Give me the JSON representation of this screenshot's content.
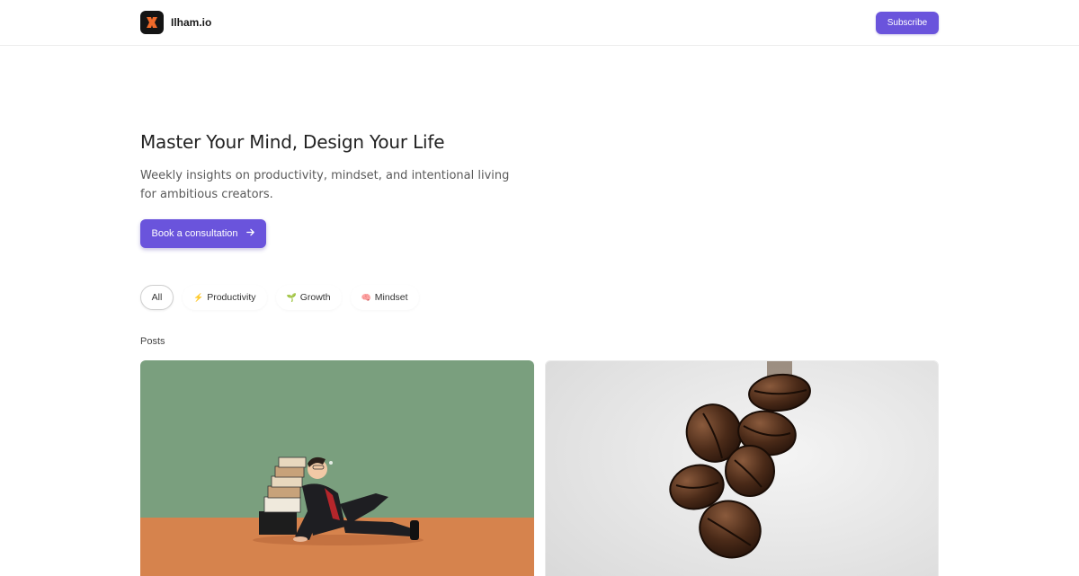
{
  "header": {
    "brand_name": "Ilham.io",
    "subscribe_label": "Subscribe"
  },
  "hero": {
    "title": "Master Your Mind, Design Your Life",
    "subtitle": "Weekly insights on productivity, mindset, and intentional living for ambitious creators.",
    "cta_label": "Book a consultation",
    "cta_icon": "arrow-right-icon"
  },
  "filters": [
    {
      "emoji": "",
      "label": "All",
      "active": true
    },
    {
      "emoji": "⚡",
      "label": "Productivity",
      "active": false
    },
    {
      "emoji": "🌱",
      "label": "Growth",
      "active": false
    },
    {
      "emoji": "🧠",
      "label": "Mindset",
      "active": false
    }
  ],
  "posts_label": "Posts",
  "colors": {
    "accent": "#6a54dc",
    "card1_wall": "#7a9f7e",
    "card1_floor": "#d6834d",
    "card2_bg": "#e6e6e6"
  }
}
